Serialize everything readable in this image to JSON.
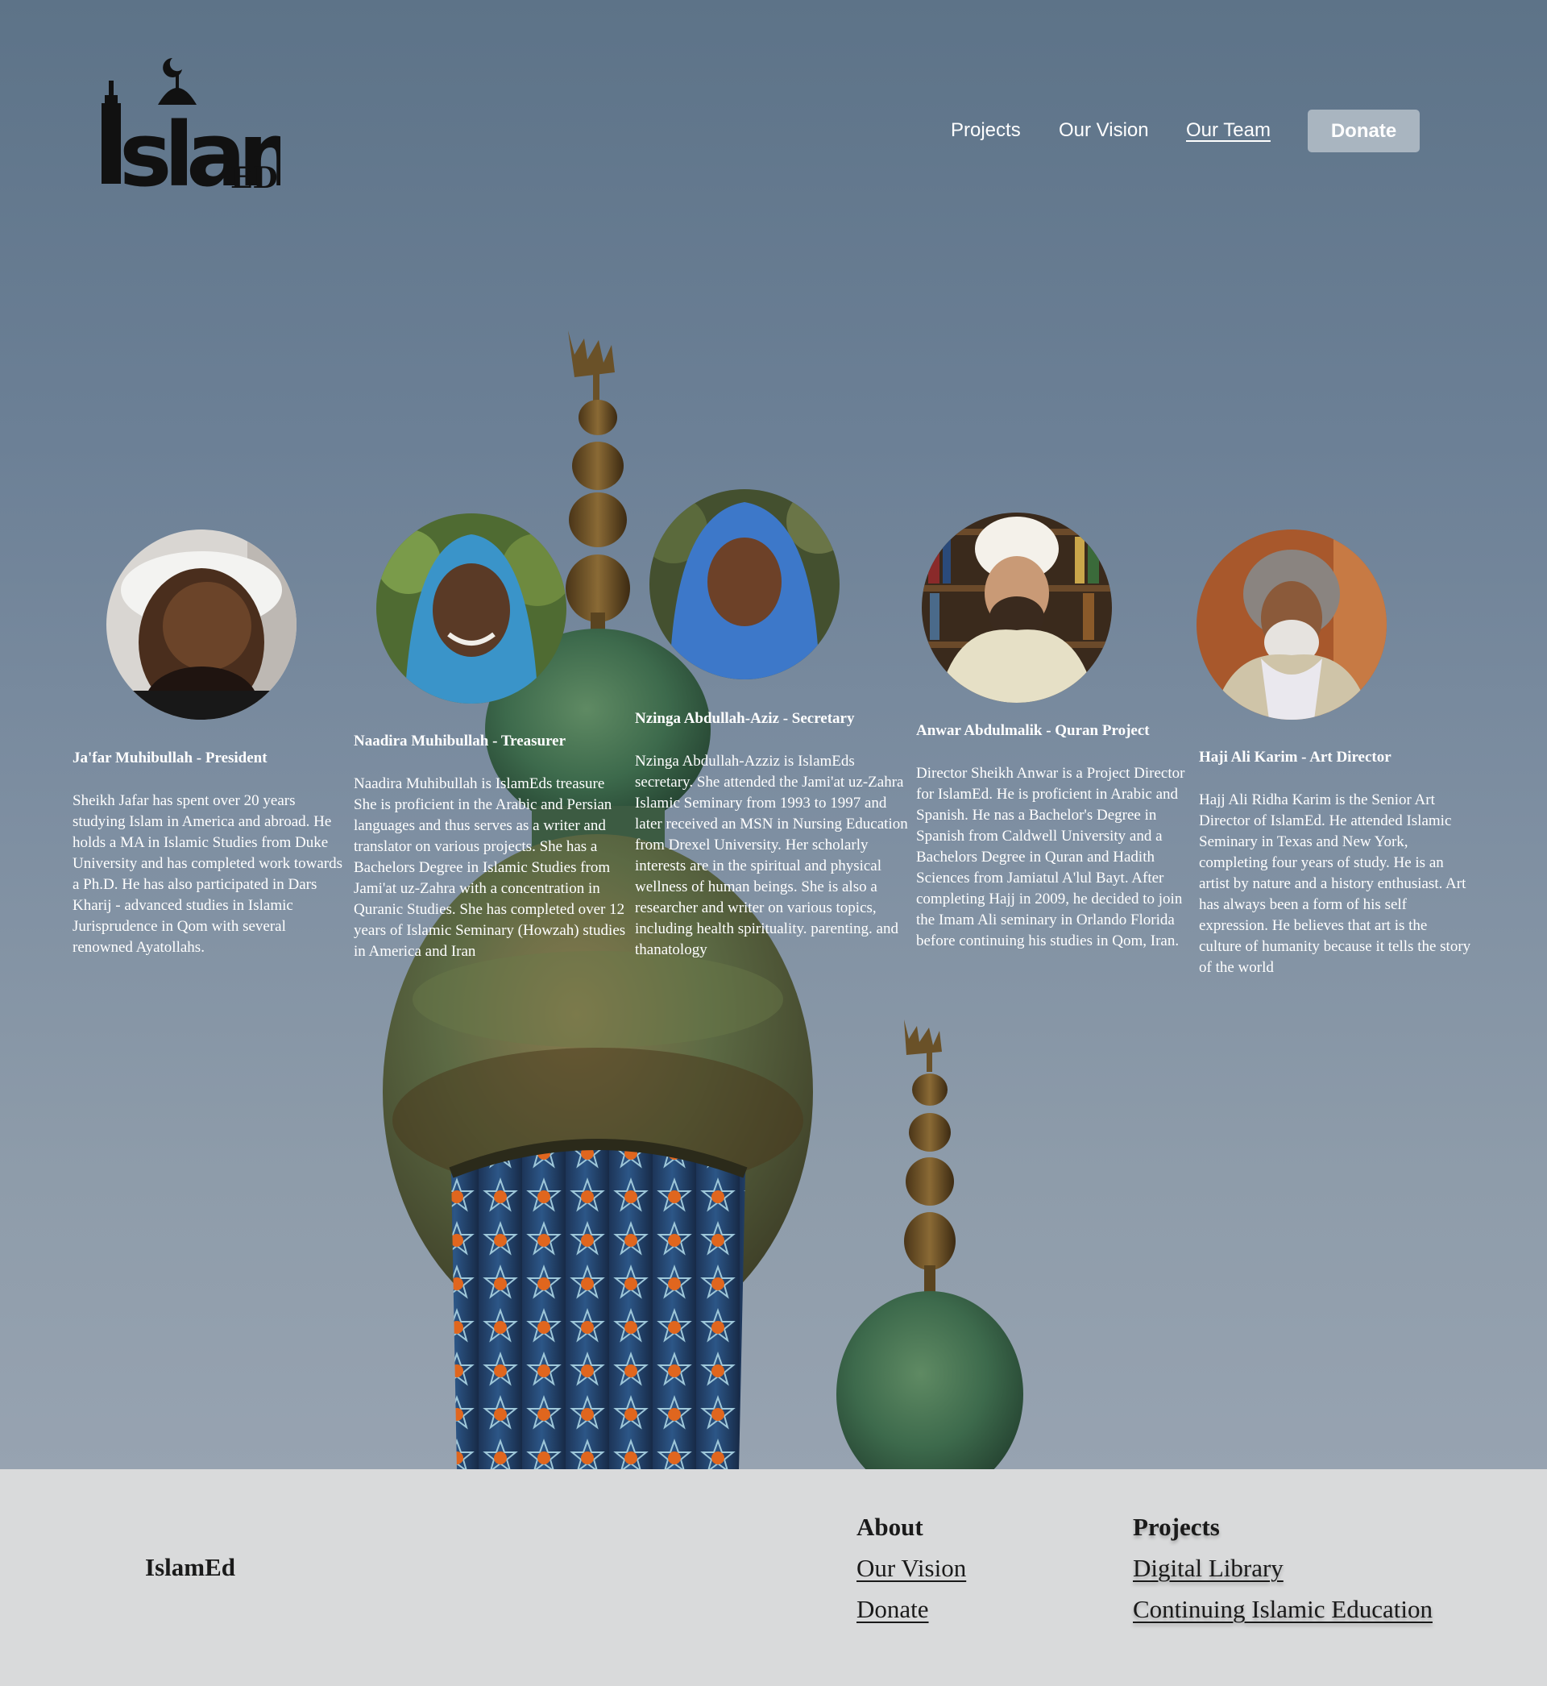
{
  "colors": {
    "sky_top": "#5d7388",
    "sky_bottom": "#97a3b1",
    "donate_button": "#a9b5c0",
    "footer_background": "#d9dadb",
    "text_light": "#ffffff",
    "text_dark": "#1a1a1a"
  },
  "header": {
    "logo_icon": "islamed-logo-icon",
    "nav": {
      "projects": "Projects",
      "vision": "Our Vision",
      "team": "Our Team",
      "donate": "Donate"
    }
  },
  "team": [
    {
      "name": "Ja'far Muhibullah - President",
      "bio": "Sheikh Jafar has spent over 20 years studying Islam in America and abroad. He holds a MA in Islamic Studies from Duke University and has completed work towards a Ph.D. He has also participated in Dars Kharij - advanced studies in Islamic Jurisprudence in Qom with several renowned Ayatollahs."
    },
    {
      "name": "Naadira Muhibullah - Treasurer",
      "bio": "Naadira Muhibullah is IslamEds treasure She is proficient in the Arabic and Persian languages and thus serves as a writer and translator on various projects. She has a Bachelors Degree in Islamic Studies from Jami'at uz-Zahra with a concentration in Quranic Studies. She has completed over 12 years of Islamic Seminary (Howzah) studies in America and Iran"
    },
    {
      "name": "Nzinga Abdullah-Aziz - Secretary",
      "bio": "Nzinga Abdullah-Azziz is IslamEds secretary. She attended the Jami'at uz-Zahra Islamic Seminary from 1993 to 1997 and later received an MSN in Nursing Education from Drexel University. Her scholarly interests are in the spiritual and physical wellness of human beings. She is also a researcher and writer on various topics, including health spirituality. parenting. and thanatology"
    },
    {
      "name": "Anwar Abdulmalik - Quran Project",
      "bio": "Director Sheikh Anwar is a Project Director for IslamEd. He is proficient in Arabic and Spanish. He nas a Bachelor's Degree in Spanish from Caldwell University and a Bachelors Degree in Quran and Hadith Sciences from Jamiatul A'lul Bayt. After completing Hajj in 2009, he decided to join the Imam Ali seminary in Orlando Florida before continuing his studies in Qom, Iran."
    },
    {
      "name": "Haji Ali Karim - Art Director",
      "bio": "Hajj Ali Ridha Karim is the Senior Art Director of IslamEd. He attended Islamic Seminary in Texas and New York, completing four years of study. He is an artist by nature and a history enthusiast. Art has always been a form of his self expression. He believes that art is the culture of humanity because it tells the story of the world"
    }
  ],
  "footer": {
    "brand": "IslamEd",
    "about_heading": "About",
    "about_links": [
      "Our Vision",
      "Donate"
    ],
    "projects_heading": "Projects",
    "projects_links": [
      "Digital Library",
      "Continuing Islamic Education"
    ]
  }
}
